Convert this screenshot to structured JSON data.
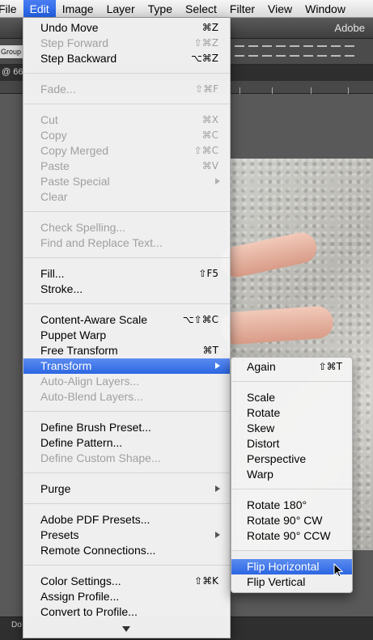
{
  "menubar": {
    "items": [
      "File",
      "Edit",
      "Image",
      "Layer",
      "Type",
      "Select",
      "Filter",
      "View",
      "Window"
    ]
  },
  "app": {
    "title": "Adobe",
    "group_label": "Group",
    "doc_tab": "@ 66",
    "status_label": "Do"
  },
  "edit_menu": {
    "items": [
      {
        "label": "Undo Move",
        "shortcut": "⌘Z",
        "disabled": false
      },
      {
        "label": "Step Forward",
        "shortcut": "⇧⌘Z",
        "disabled": true
      },
      {
        "label": "Step Backward",
        "shortcut": "⌥⌘Z",
        "disabled": false
      },
      {
        "label": "Fade...",
        "shortcut": "⇧⌘F",
        "disabled": true
      },
      {
        "label": "Cut",
        "shortcut": "⌘X",
        "disabled": true
      },
      {
        "label": "Copy",
        "shortcut": "⌘C",
        "disabled": true
      },
      {
        "label": "Copy Merged",
        "shortcut": "⇧⌘C",
        "disabled": true
      },
      {
        "label": "Paste",
        "shortcut": "⌘V",
        "disabled": true
      },
      {
        "label": "Paste Special",
        "shortcut": "",
        "disabled": true,
        "submenu": true
      },
      {
        "label": "Clear",
        "shortcut": "",
        "disabled": true
      },
      {
        "label": "Check Spelling...",
        "shortcut": "",
        "disabled": true
      },
      {
        "label": "Find and Replace Text...",
        "shortcut": "",
        "disabled": true
      },
      {
        "label": "Fill...",
        "shortcut": "⇧F5",
        "disabled": false
      },
      {
        "label": "Stroke...",
        "shortcut": "",
        "disabled": false
      },
      {
        "label": "Content-Aware Scale",
        "shortcut": "⌥⇧⌘C",
        "disabled": false
      },
      {
        "label": "Puppet Warp",
        "shortcut": "",
        "disabled": false
      },
      {
        "label": "Free Transform",
        "shortcut": "⌘T",
        "disabled": false
      },
      {
        "label": "Transform",
        "shortcut": "",
        "disabled": false,
        "submenu": true,
        "highlighted": true
      },
      {
        "label": "Auto-Align Layers...",
        "shortcut": "",
        "disabled": true
      },
      {
        "label": "Auto-Blend Layers...",
        "shortcut": "",
        "disabled": true
      },
      {
        "label": "Define Brush Preset...",
        "shortcut": "",
        "disabled": false
      },
      {
        "label": "Define Pattern...",
        "shortcut": "",
        "disabled": false
      },
      {
        "label": "Define Custom Shape...",
        "shortcut": "",
        "disabled": true
      },
      {
        "label": "Purge",
        "shortcut": "",
        "disabled": false,
        "submenu": true
      },
      {
        "label": "Adobe PDF Presets...",
        "shortcut": "",
        "disabled": false
      },
      {
        "label": "Presets",
        "shortcut": "",
        "disabled": false,
        "submenu": true
      },
      {
        "label": "Remote Connections...",
        "shortcut": "",
        "disabled": false
      },
      {
        "label": "Color Settings...",
        "shortcut": "⇧⌘K",
        "disabled": false
      },
      {
        "label": "Assign Profile...",
        "shortcut": "",
        "disabled": false
      },
      {
        "label": "Convert to Profile...",
        "shortcut": "",
        "disabled": false
      }
    ]
  },
  "transform_menu": {
    "items": [
      {
        "label": "Again",
        "shortcut": "⇧⌘T"
      },
      {
        "label": "Scale",
        "shortcut": ""
      },
      {
        "label": "Rotate",
        "shortcut": ""
      },
      {
        "label": "Skew",
        "shortcut": ""
      },
      {
        "label": "Distort",
        "shortcut": ""
      },
      {
        "label": "Perspective",
        "shortcut": ""
      },
      {
        "label": "Warp",
        "shortcut": ""
      },
      {
        "label": "Rotate 180°",
        "shortcut": ""
      },
      {
        "label": "Rotate 90° CW",
        "shortcut": ""
      },
      {
        "label": "Rotate 90° CCW",
        "shortcut": ""
      },
      {
        "label": "Flip Horizontal",
        "shortcut": "",
        "highlighted": true
      },
      {
        "label": "Flip Vertical",
        "shortcut": ""
      }
    ]
  },
  "colors": {
    "highlight": "#2c66e2",
    "disabled_text": "#a0a0a0"
  }
}
